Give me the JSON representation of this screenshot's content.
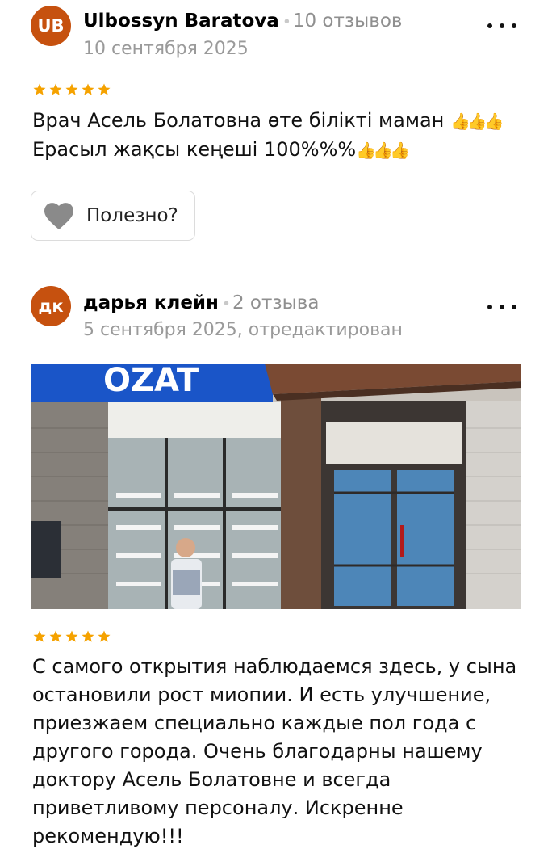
{
  "reviews": [
    {
      "avatar_initials": "UB",
      "author": "Ulbossyn Baratova",
      "review_count": "10 отзывов",
      "date": "10 сентября 2025",
      "rating": 5,
      "text_line1": "Врач Асель Болатовна өте білікті маман",
      "text_line2": "Ерасыл жақсы кеңеші 100%%%",
      "thumbs_emoji": "👍👍👍",
      "helpful_label": "Полезно?"
    },
    {
      "avatar_initials": "дк",
      "author": "дарья клейн",
      "review_count": "2 отзыва",
      "date": "5 сентября 2025, отредактирован",
      "rating": 5,
      "photo_sign_text": "OZAT",
      "text": "С самого открытия наблюдаемся здесь, у сына остановили рост миопии. И есть улучшение, приезжаем специально каждые пол года с другого города. Очень благодарны нашему доктору Асель Болатовне и всегда приветливому персоналу. Искренне рекомендую!!!"
    }
  ],
  "colors": {
    "avatar": "#c6510f",
    "star": "#f5a200",
    "heart": "#8a8a8a",
    "sign_blue": "#1a55c8"
  },
  "icons": {
    "more": "more-dots-icon",
    "heart": "heart-icon",
    "star": "star-icon"
  }
}
